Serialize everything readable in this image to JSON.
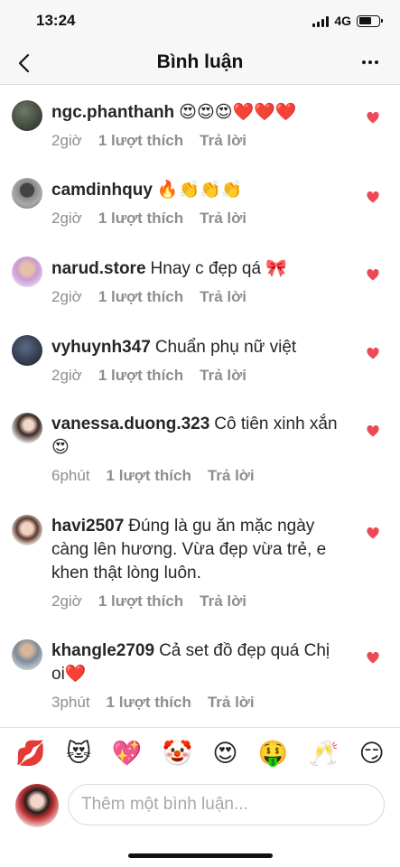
{
  "status_bar": {
    "time": "13:24",
    "network": "4G"
  },
  "header": {
    "title": "Bình luận"
  },
  "comments": [
    {
      "username": "ngc.phanthanh",
      "text": "😍😍😍❤️❤️❤️",
      "time": "2giờ",
      "likes": "1 lượt thích",
      "reply": "Trả lời"
    },
    {
      "username": "camdinhquy",
      "text": "🔥👏👏👏",
      "time": "2giờ",
      "likes": "1 lượt thích",
      "reply": "Trả lời"
    },
    {
      "username": "narud.store",
      "text": "Hnay c đẹp qá 🎀",
      "time": "2giờ",
      "likes": "1 lượt thích",
      "reply": "Trả lời"
    },
    {
      "username": "vyhuynh347",
      "text": "Chuẩn phụ nữ việt",
      "time": "2giờ",
      "likes": "1 lượt thích",
      "reply": "Trả lời"
    },
    {
      "username": "vanessa.duong.323",
      "text": "Cô tiên xinh xắn 😍",
      "time": "6phút",
      "likes": "1 lượt thích",
      "reply": "Trả lời"
    },
    {
      "username": "havi2507",
      "text": "Đúng là gu ăn mặc ngày càng lên hương. Vừa đẹp vừa trẻ, e khen thật lòng luôn.",
      "time": "2giờ",
      "likes": "1 lượt thích",
      "reply": "Trả lời"
    },
    {
      "username": "khangle2709",
      "text": "Cả set đồ đẹp quá Chị oi❤️",
      "time": "3phút",
      "likes": "1 lượt thích",
      "reply": "Trả lời"
    }
  ],
  "emoji_bar": [
    "💋",
    "😻",
    "💖",
    "🤡",
    "😍",
    "🤑",
    "🥂",
    "😏"
  ],
  "composer": {
    "placeholder": "Thêm một bình luận..."
  },
  "colors": {
    "like_heart": "#ed4956",
    "muted_text": "#8e8e8e",
    "divider": "#dbdbdb"
  }
}
